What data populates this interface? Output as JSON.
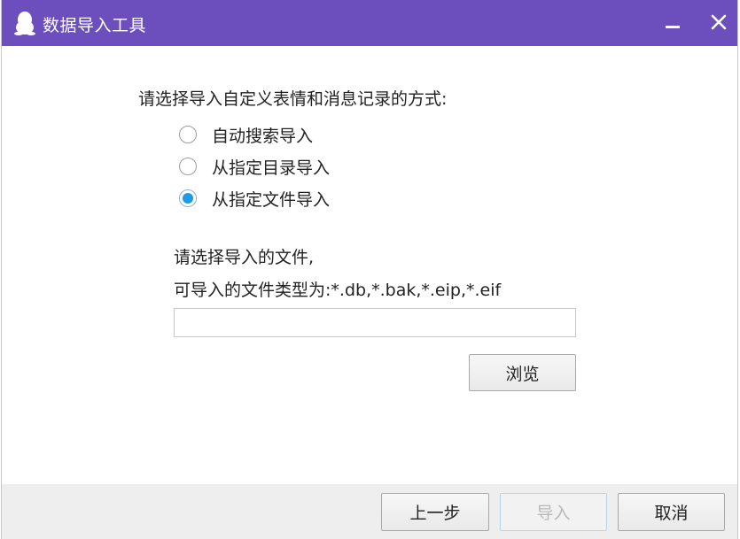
{
  "window": {
    "title": "数据导入工具",
    "titlebar_color": "#6c4fbd",
    "icons": {
      "app": "qq-penguin-icon",
      "minimize": "minimize-icon",
      "close": "close-icon"
    }
  },
  "main": {
    "prompt": "请选择导入自定义表情和消息记录的方式:",
    "options": [
      {
        "label": "自动搜索导入",
        "checked": false
      },
      {
        "label": "从指定目录导入",
        "checked": false
      },
      {
        "label": "从指定文件导入",
        "checked": true
      }
    ],
    "file_prompt_line1": "请选择导入的文件,",
    "file_prompt_line2": "可导入的文件类型为:*.db,*.bak,*.eip,*.eif",
    "file_path_value": "",
    "browse_label": "浏览"
  },
  "footer": {
    "prev_label": "上一步",
    "import_label": "导入",
    "import_enabled": false,
    "cancel_label": "取消"
  }
}
